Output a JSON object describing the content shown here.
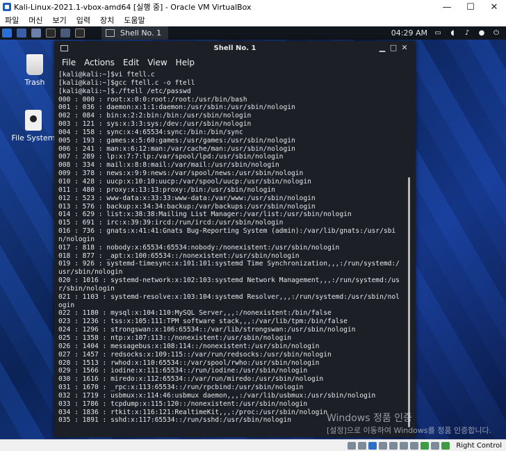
{
  "host_window": {
    "title": "Kali-Linux-2021.1-vbox-amd64 [실행 중] - Oracle VM VirtualBox",
    "min_glyph": "—",
    "max_glyph": "☐",
    "close_glyph": "✕"
  },
  "host_menu": [
    "파일",
    "머신",
    "보기",
    "입력",
    "장치",
    "도움말"
  ],
  "panel": {
    "task_label": "Shell No. 1",
    "clock": "04:29 AM",
    "sys_icons": [
      "monitor-icon",
      "volume-icon",
      "notification-bell-icon",
      "power-dot-icon",
      "lock-icon"
    ]
  },
  "desktop_icons": [
    {
      "label": "Trash",
      "icon": "trash-icon"
    },
    {
      "label": "File System",
      "icon": "drive-icon"
    }
  ],
  "terminal": {
    "title": "Shell No. 1",
    "menu": [
      "File",
      "Actions",
      "Edit",
      "View",
      "Help"
    ],
    "lines": [
      "[kali@kali:~]$vi ftell.c",
      "[kali@kali:~]$gcc ftell.c -o ftell",
      "[kali@kali:~]$./ftell /etc/passwd",
      "000 : 000 : root:x:0:0:root:/root:/usr/bin/bash",
      "001 : 036 : daemon:x:1:1:daemon:/usr/sbin:/usr/sbin/nologin",
      "002 : 084 : bin:x:2:2:bin:/bin:/usr/sbin/nologin",
      "003 : 121 : sys:x:3:3:sys:/dev:/usr/sbin/nologin",
      "004 : 158 : sync:x:4:65534:sync:/bin:/bin/sync",
      "005 : 193 : games:x:5:60:games:/usr/games:/usr/sbin/nologin",
      "006 : 241 : man:x:6:12:man:/var/cache/man:/usr/sbin/nologin",
      "007 : 289 : lp:x:7:7:lp:/var/spool/lpd:/usr/sbin/nologin",
      "008 : 334 : mail:x:8:8:mail:/var/mail:/usr/sbin/nologin",
      "009 : 378 : news:x:9:9:news:/var/spool/news:/usr/sbin/nologin",
      "010 : 428 : uucp:x:10:10:uucp:/var/spool/uucp:/usr/sbin/nologin",
      "011 : 480 : proxy:x:13:13:proxy:/bin:/usr/sbin/nologin",
      "012 : 523 : www-data:x:33:33:www-data:/var/www:/usr/sbin/nologin",
      "013 : 576 : backup:x:34:34:backup:/var/backups:/usr/sbin/nologin",
      "014 : 629 : list:x:38:38:Mailing List Manager:/var/list:/usr/sbin/nologin",
      "015 : 691 : irc:x:39:39:ircd:/run/ircd:/usr/sbin/nologin",
      "016 : 736 : gnats:x:41:41:Gnats Bug-Reporting System (admin):/var/lib/gnats:/usr/sbin/nologin",
      "017 : 818 : nobody:x:65534:65534:nobody:/nonexistent:/usr/sbin/nologin",
      "018 : 877 : _apt:x:100:65534::/nonexistent:/usr/sbin/nologin",
      "019 : 926 : systemd-timesync:x:101:101:systemd Time Synchronization,,,:/run/systemd:/usr/sbin/nologin",
      "020 : 1016 : systemd-network:x:102:103:systemd Network Management,,,:/run/systemd:/usr/sbin/nologin",
      "021 : 1103 : systemd-resolve:x:103:104:systemd Resolver,,,:/run/systemd:/usr/sbin/nologin",
      "022 : 1180 : mysql:x:104:110:MySQL Server,,,:/nonexistent:/bin/false",
      "023 : 1236 : tss:x:105:111:TPM software stack,,,:/var/lib/tpm:/bin/false",
      "024 : 1296 : strongswan:x:106:65534::/var/lib/strongswan:/usr/sbin/nologin",
      "025 : 1358 : ntp:x:107:113::/nonexistent:/usr/sbin/nologin",
      "026 : 1404 : messagebus:x:108:114::/nonexistent:/usr/sbin/nologin",
      "027 : 1457 : redsocks:x:109:115::/var/run/redsocks:/usr/sbin/nologin",
      "028 : 1513 : rwhod:x:110:65534::/var/spool/rwho:/usr/sbin/nologin",
      "029 : 1566 : iodine:x:111:65534::/run/iodine:/usr/sbin/nologin",
      "030 : 1616 : miredo:x:112:65534::/var/run/miredo:/usr/sbin/nologin",
      "031 : 1670 : _rpc:x:113:65534::/run/rpcbind:/usr/sbin/nologin",
      "032 : 1719 : usbmux:x:114:46:usbmux daemon,,,:/var/lib/usbmux:/usr/sbin/nologin",
      "033 : 1786 : tcpdump:x:115:120::/nonexistent:/usr/sbin/nologin",
      "034 : 1836 : rtkit:x:116:121:RealtimeKit,,,:/proc:/usr/sbin/nologin",
      "035 : 1891 : sshd:x:117:65534::/run/sshd:/usr/sbin/nologin"
    ],
    "scroll_position": 0.92
  },
  "activation_watermark": {
    "line1": "Windows 정품 인증",
    "line2": "[설정]으로 이동하여 Windows를 정품 인증합니다."
  },
  "status_bar": {
    "host_key": "Right Control"
  }
}
